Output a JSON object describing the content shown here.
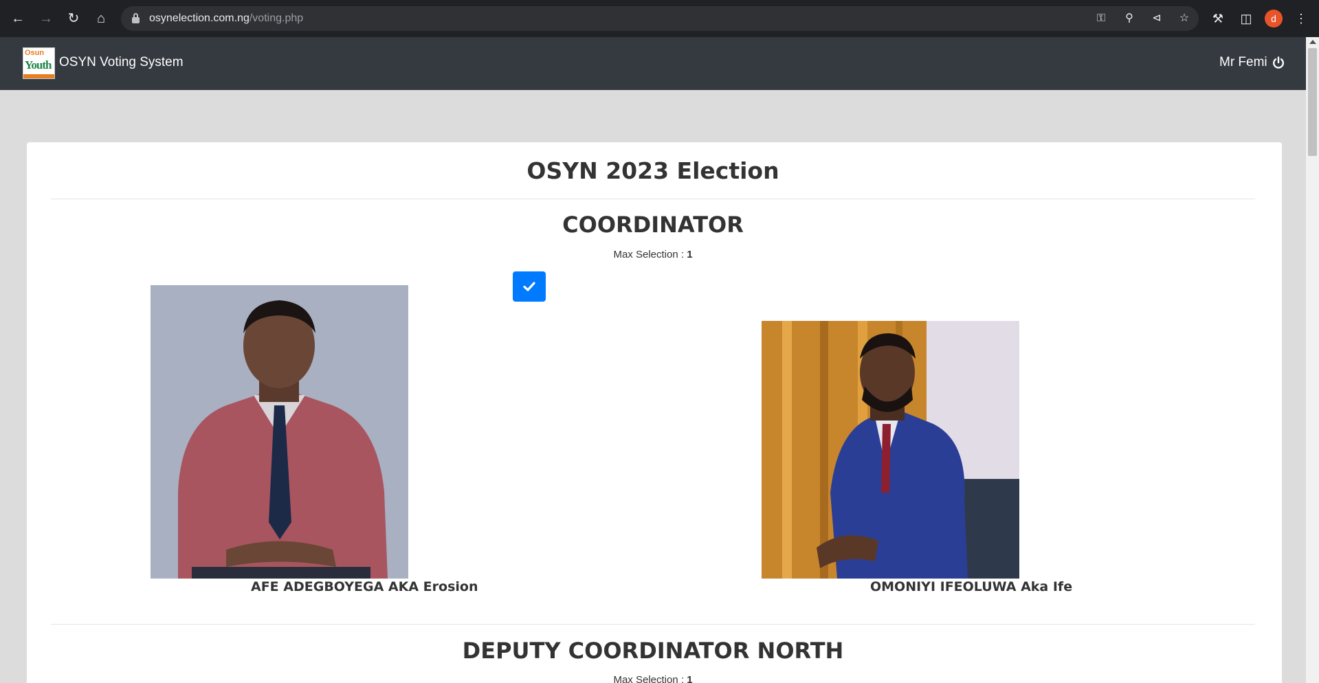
{
  "browser": {
    "url_host": "osynelection.com.ng",
    "url_path": "/voting.php",
    "profile_initial": "d"
  },
  "navbar": {
    "brand": "OSYN Voting System",
    "user": "Mr Femi",
    "logo_text_top": "Osun",
    "logo_text_main": "Youth"
  },
  "ballot": {
    "title": "OSYN 2023 Election",
    "max_selection_label": "Max Selection : ",
    "positions": [
      {
        "title": "COORDINATOR",
        "max_selection": "1",
        "candidates": [
          {
            "name": "AFE ADEGBOYEGA AKA Erosion",
            "selected": true
          },
          {
            "name": "OMONIYI IFEOLUWA Aka Ife",
            "selected": false
          }
        ]
      },
      {
        "title": "DEPUTY COORDINATOR NORTH",
        "max_selection": "1"
      }
    ]
  },
  "colors": {
    "navbar_bg": "#343a40",
    "primary": "#007bff",
    "page_bg": "#dcdcdc"
  }
}
